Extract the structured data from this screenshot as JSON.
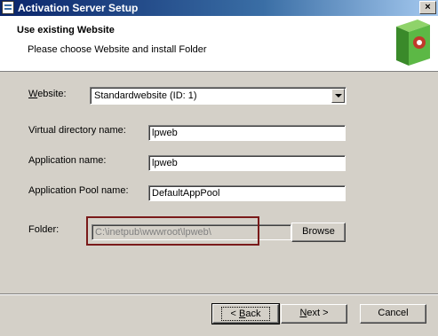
{
  "window": {
    "title": "Activation Server Setup",
    "close_glyph": "×"
  },
  "header": {
    "title": "Use existing Website",
    "subtitle": "Please choose Website and install Folder"
  },
  "form": {
    "website_label_pre": "W",
    "website_label_rest": "ebsite:",
    "website_value": "Standardwebsite (ID: 1)",
    "vdir_label": "Virtual directory name:",
    "vdir_value": "lpweb",
    "app_label": "Application name:",
    "app_value": "lpweb",
    "pool_label": "Application Pool name:",
    "pool_value": "DefaultAppPool",
    "folder_label": "Folder:",
    "folder_value": "C:\\inetpub\\wwwroot\\lpweb\\",
    "browse_label": "Browse"
  },
  "buttons": {
    "back_pre": "< ",
    "back_u": "B",
    "back_rest": "ack",
    "next_u": "N",
    "next_rest": "ext >",
    "cancel": "Cancel"
  },
  "colors": {
    "highlight_border": "#7a1a1a",
    "titlebar": "#0a246a"
  }
}
